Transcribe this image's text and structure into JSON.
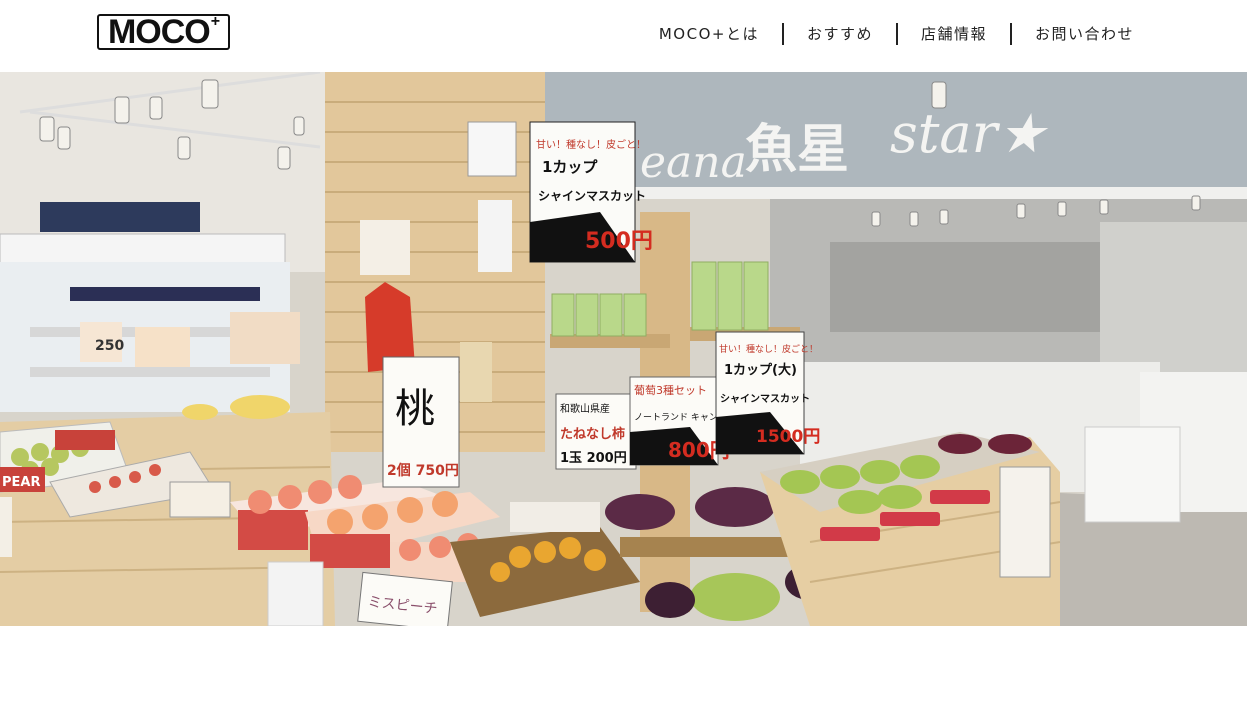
{
  "header": {
    "logo_text": "MOCO",
    "logo_plus": "+"
  },
  "nav": {
    "items": [
      {
        "label": "MOCO+とは"
      },
      {
        "label": "おすすめ"
      },
      {
        "label": "店舗情報"
      },
      {
        "label": "お問い合わせ"
      }
    ]
  },
  "hero": {
    "signs": {
      "store_name_a": "eana",
      "store_name_b": "魚星",
      "store_name_c": "star★",
      "shine1_top": "甘い！種なし！皮ごと！",
      "shine1_title": "1カップ",
      "shine1_name": "シャインマスカット",
      "shine1_price": "500円",
      "momo_title": "桃",
      "momo_price": "2個 750円",
      "kaki_origin": "和歌山県産",
      "kaki_name": "たねなし柿",
      "kaki_price": "1玉 200円",
      "grape_title": "葡萄3種セット",
      "grape_sub": "ノートランド キャンベル",
      "grape_price": "800円",
      "shine2_top": "甘い！種なし！皮ごと！",
      "shine2_title": "1カップ(大)",
      "shine2_name": "シャインマスカット",
      "shine2_price": "1500円",
      "pear_label": "PEAR",
      "price_250": "250",
      "miss_peach": "ミスピーチ"
    }
  }
}
